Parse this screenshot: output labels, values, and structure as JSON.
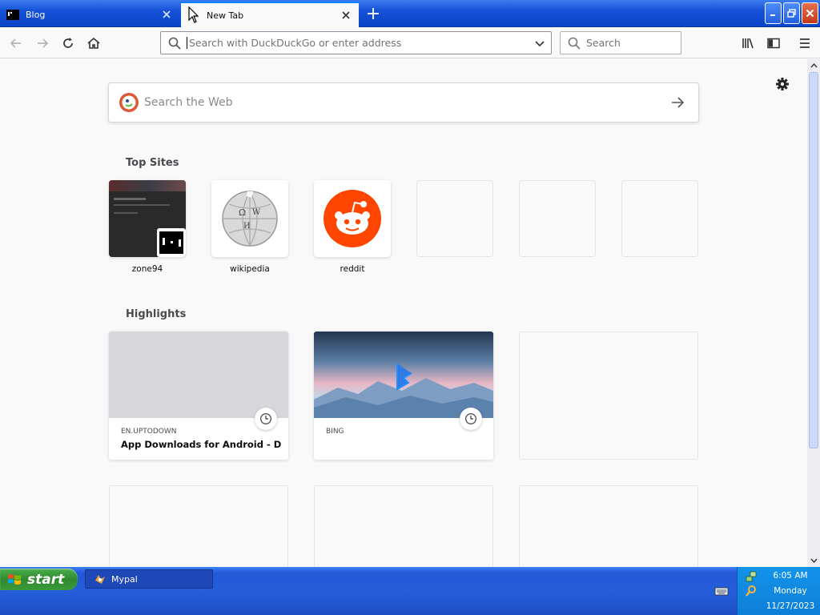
{
  "browser": {
    "tabs": [
      {
        "label": "Blog",
        "active": false
      },
      {
        "label": "New Tab",
        "active": true
      }
    ],
    "url_placeholder": "Search with DuckDuckGo or enter address",
    "search_placeholder": "Search"
  },
  "newtab": {
    "web_search_placeholder": "Search the Web",
    "top_sites_title": "Top Sites",
    "top_sites": [
      {
        "name": "zone94"
      },
      {
        "name": "wikipedia"
      },
      {
        "name": "reddit"
      }
    ],
    "highlights_title": "Highlights",
    "highlights": [
      {
        "source": "EN.UPTODOWN",
        "title": "App Downloads for Android - Do..."
      },
      {
        "source": "BING",
        "title": ""
      }
    ]
  },
  "taskbar": {
    "start_label": "start",
    "items": [
      {
        "label": "Mypal"
      }
    ],
    "clock": {
      "time": "6:05 AM",
      "day": "Monday",
      "date": "11/27/2023"
    }
  },
  "colors": {
    "accent": "#0a84ff",
    "reddit": "#ff4500",
    "xp_blue": "#245ddb",
    "start_green": "#3a9a3a"
  },
  "icons": [
    "back-icon",
    "forward-icon",
    "reload-icon",
    "home-icon",
    "search-icon",
    "chevron-down-icon",
    "library-icon",
    "sidebar-icon",
    "menu-icon",
    "gear-icon",
    "arrow-right-icon",
    "clock-icon",
    "duckduckgo-icon",
    "windows-flag-icon",
    "keyboard-icon"
  ]
}
